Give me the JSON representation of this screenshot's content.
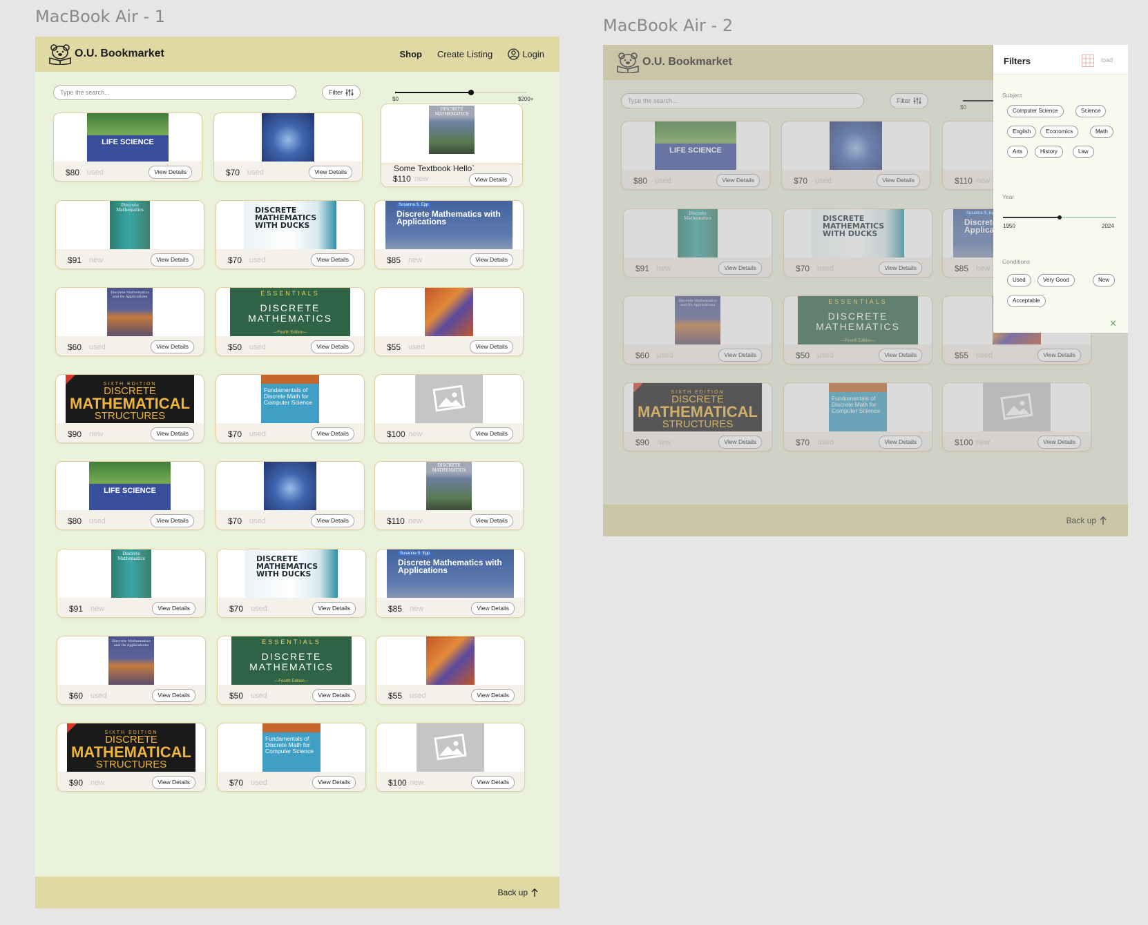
{
  "frames": [
    {
      "label": "MacBook Air - 1"
    },
    {
      "label": "MacBook Air - 2"
    }
  ],
  "header": {
    "brand": "O.U. Bookmarket",
    "nav": {
      "shop": "Shop",
      "create": "Create Listing",
      "login": "Login"
    }
  },
  "search": {
    "placeholder": "Type the search..."
  },
  "filter_button": {
    "label": "Filter",
    "icon": "sliders-icon"
  },
  "price_slider": {
    "min_label": "$0",
    "max_label": "$200+",
    "value_fraction": 0.58
  },
  "featured": {
    "title": "Some Textbook Hello`",
    "price": "$110",
    "condition": "new"
  },
  "details_label": "View Details",
  "listings": [
    {
      "price": "$80",
      "condition": "used",
      "cover": "life"
    },
    {
      "price": "$70",
      "condition": "used",
      "cover": "blue"
    },
    {
      "price": "$110",
      "condition": "new",
      "cover": "dmpaint"
    },
    {
      "price": "$91",
      "condition": "new",
      "cover": "teal"
    },
    {
      "price": "$70",
      "condition": "used",
      "cover": "ducks"
    },
    {
      "price": "$85",
      "condition": "new",
      "cover": "epp"
    },
    {
      "price": "$60",
      "condition": "used",
      "cover": "purple"
    },
    {
      "price": "$50",
      "condition": "used",
      "cover": "essent"
    },
    {
      "price": "$55",
      "condition": "used",
      "cover": "orange"
    },
    {
      "price": "$90",
      "condition": "new",
      "cover": "struct"
    },
    {
      "price": "$70",
      "condition": "used",
      "cover": "fund"
    },
    {
      "price": "$100",
      "condition": "new",
      "cover": "ph"
    },
    {
      "price": "$80",
      "condition": "used",
      "cover": "life"
    },
    {
      "price": "$70",
      "condition": "used",
      "cover": "blue"
    },
    {
      "price": "$110",
      "condition": "new",
      "cover": "dmpaint"
    },
    {
      "price": "$91",
      "condition": "new",
      "cover": "teal"
    },
    {
      "price": "$70",
      "condition": "used",
      "cover": "ducks"
    },
    {
      "price": "$85",
      "condition": "new",
      "cover": "epp"
    },
    {
      "price": "$60",
      "condition": "used",
      "cover": "purple"
    },
    {
      "price": "$50",
      "condition": "used",
      "cover": "essent"
    },
    {
      "price": "$55",
      "condition": "used",
      "cover": "orange"
    },
    {
      "price": "$90",
      "condition": "new",
      "cover": "struct"
    },
    {
      "price": "$70",
      "condition": "used",
      "cover": "fund"
    },
    {
      "price": "$100",
      "condition": "new",
      "cover": "ph"
    }
  ],
  "cover_text": {
    "life": "LIFE SCIENCE",
    "dmpaint": "DISCRETE MATHEMATICS",
    "teal": "Discrete Mathematics",
    "ducks": "DISCRETE MATHEMATICS WITH DUCKS",
    "epp_author": "Susanna S. Epp",
    "epp": "Discrete Mathematics with Applications",
    "purple": "Discrete Mathematics and Its Applications",
    "essent_top": "ESSENTIALS",
    "essent": "DISCRETE MATHEMATICS",
    "essent_ed": "—Fourth Edition—",
    "struct_ed": "SIXTH EDITION",
    "struct_1": "DISCRETE",
    "struct_2": "MATHEMATICAL",
    "struct_3": "STRUCTURES",
    "fund": "Fundamentals of Discrete Math for Computer Science"
  },
  "footer": {
    "back_label": "Back up"
  },
  "filters": {
    "title": "Filters",
    "load_label": "load",
    "subject_label": "Subject",
    "subjects": [
      "Computer Science",
      "Science",
      "English",
      "Economics",
      "Math",
      "Arts",
      "History",
      "Law"
    ],
    "year_label": "Year",
    "year_min": "1950",
    "year_max": "2024",
    "year_fraction": 0.5,
    "conditions_label": "Conditions",
    "conditions": [
      "Used",
      "Very Good",
      "New",
      "Acceptable"
    ],
    "close_icon": "close-icon"
  },
  "colors": {
    "background": "#eaf2dc",
    "header": "#e0d9a4",
    "card_border": "#e2cf9d"
  }
}
